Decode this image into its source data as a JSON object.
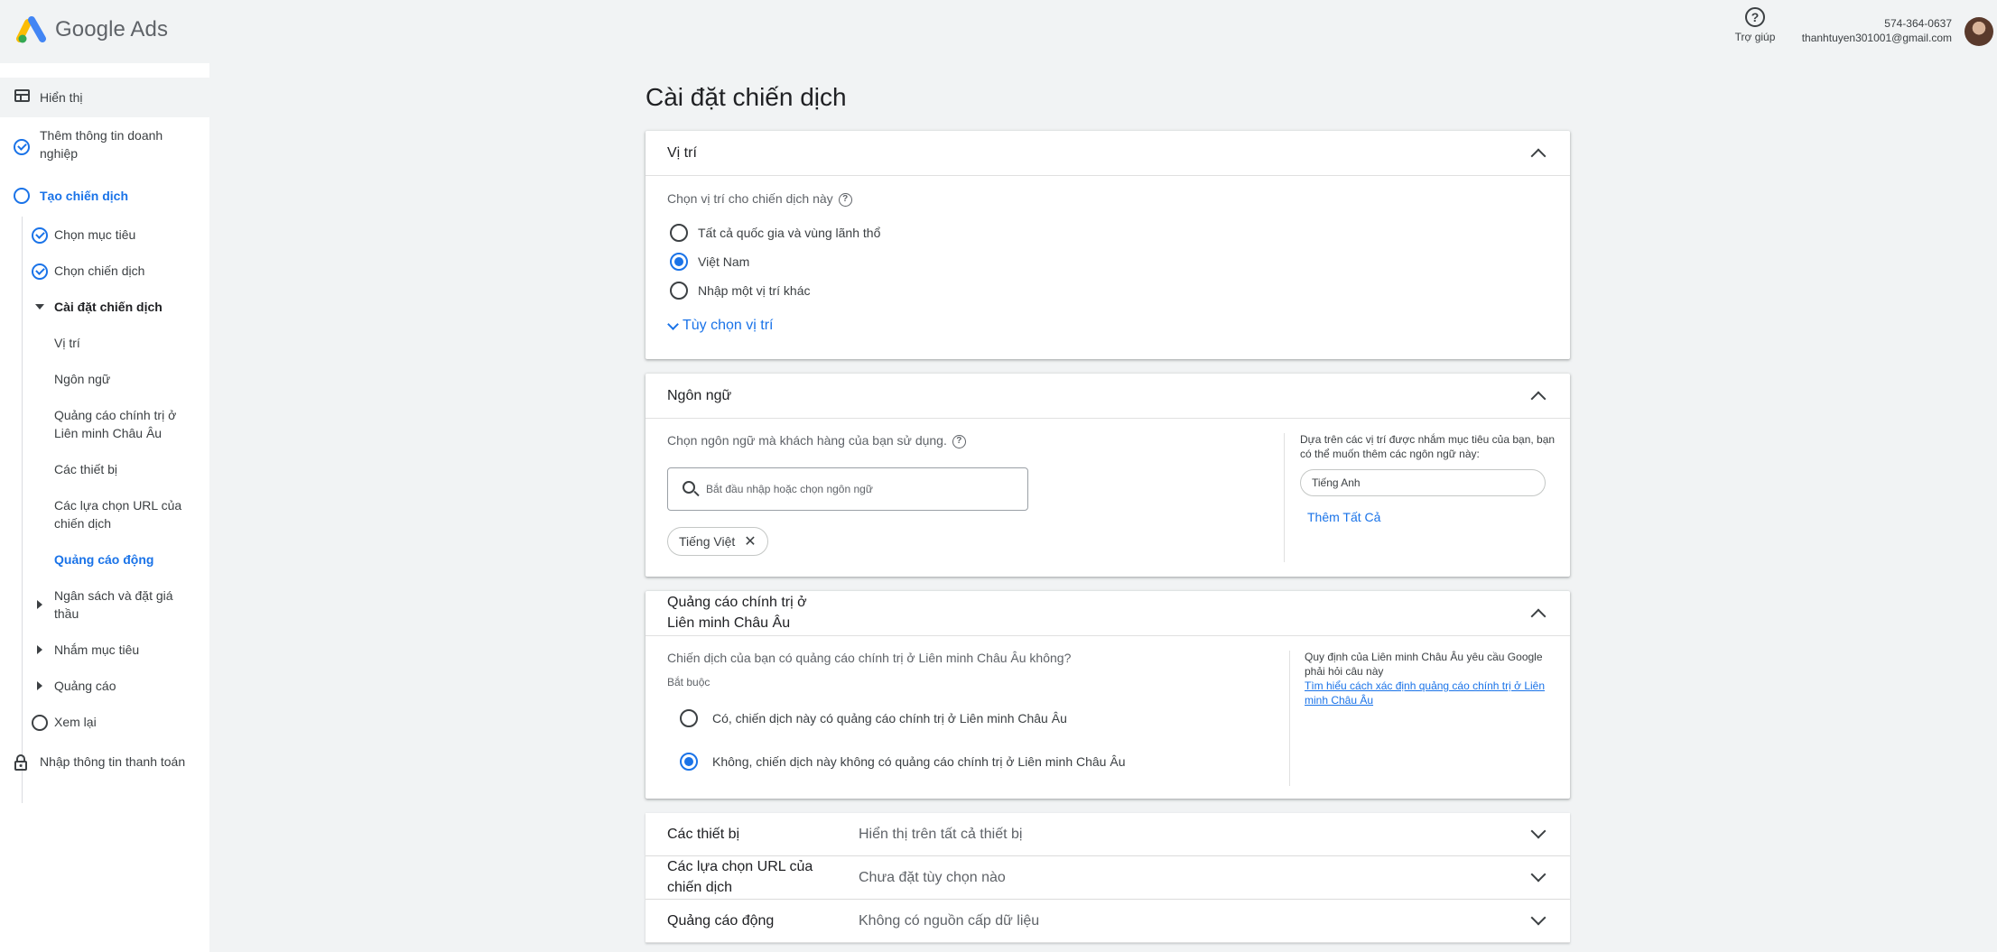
{
  "header": {
    "logo_text": "Google Ads",
    "help_label": "Trợ giúp",
    "phone": "574-364-0637",
    "email": "thanhtuyen301001@gmail.com"
  },
  "sidebar": {
    "items": [
      {
        "label": "Hiển thị"
      },
      {
        "label": "Thêm thông tin doanh nghiệp"
      },
      {
        "label": "Tạo chiến dịch"
      },
      {
        "label": "Chọn mục tiêu"
      },
      {
        "label": "Chọn chiến dịch"
      },
      {
        "label": "Cài đặt chiến dịch"
      },
      {
        "label": "Vị trí"
      },
      {
        "label": "Ngôn ngữ"
      },
      {
        "label": "Quảng cáo chính trị ở Liên minh Châu Âu"
      },
      {
        "label": "Các thiết bị"
      },
      {
        "label": "Các lựa chọn URL của chiến dịch"
      },
      {
        "label": "Quảng cáo động"
      },
      {
        "label": "Ngân sách và đặt giá thầu"
      },
      {
        "label": "Nhắm mục tiêu"
      },
      {
        "label": "Quảng cáo"
      },
      {
        "label": "Xem lại"
      },
      {
        "label": "Nhập thông tin thanh toán"
      }
    ]
  },
  "main": {
    "title": "Cài đặt chiến dịch",
    "location": {
      "title": "Vị trí",
      "prompt": "Chọn vị trí cho chiến dịch này",
      "options": [
        {
          "label": "Tất cả quốc gia và vùng lãnh thổ",
          "selected": false
        },
        {
          "label": "Việt Nam",
          "selected": true
        },
        {
          "label": "Nhập một vị trí khác",
          "selected": false
        }
      ],
      "more_options": "Tùy chọn vị trí"
    },
    "language": {
      "title": "Ngôn ngữ",
      "prompt": "Chọn ngôn ngữ mà khách hàng của bạn sử dụng.",
      "search_placeholder": "Bắt đầu nhập hoặc chọn ngôn ngữ",
      "selected_chip": "Tiếng Việt",
      "suggest_text": "Dựa trên các vị trí được nhắm mục tiêu của bạn, bạn có thể muốn thêm các ngôn ngữ này:",
      "suggest_chip": "Tiếng Anh",
      "add_all": "Thêm Tất Cả"
    },
    "eu_political": {
      "title": "Quảng cáo chính trị ở Liên minh Châu Âu",
      "question": "Chiến dịch của bạn có quảng cáo chính trị ở Liên minh Châu Âu không?",
      "required": "Bắt buộc",
      "options": [
        {
          "label": "Có, chiến dịch này có quảng cáo chính trị ở Liên minh Châu Âu",
          "selected": false
        },
        {
          "label": "Không, chiến dịch này không có quảng cáo chính trị ở Liên minh Châu Âu",
          "selected": true
        }
      ],
      "note": "Quy định của Liên minh Châu Âu yêu cầu Google phải hỏi câu này",
      "note_link": "Tìm hiểu cách xác định quảng cáo chính trị ở Liên minh Châu Âu"
    },
    "collapsed_rows": [
      {
        "title": "Các thiết bị",
        "value": "Hiển thị trên tất cả thiết bị"
      },
      {
        "title": "Các lựa chọn URL của chiến dịch",
        "value": "Chưa đặt tùy chọn nào"
      },
      {
        "title": "Quảng cáo động",
        "value": "Không có nguồn cấp dữ liệu"
      }
    ]
  }
}
